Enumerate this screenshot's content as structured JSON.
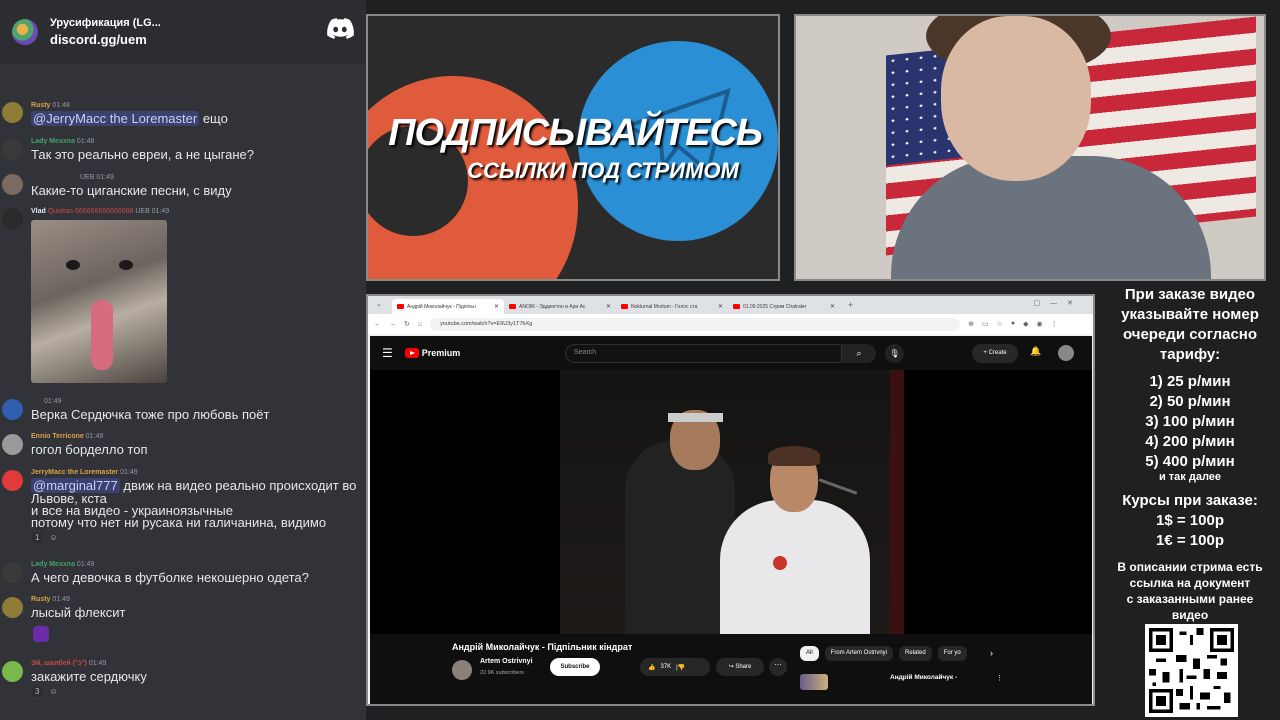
{
  "chat": {
    "server_name": "Урусификация (LG...",
    "server_invite": "discord.gg/uem",
    "messages": [
      {
        "author": "Rusty",
        "time": "01:48",
        "text": "ещо",
        "mention": "@JerryMacc the Loremaster",
        "author_color": "#d9a24a"
      },
      {
        "author": "Lady Mexxna",
        "time": "01:48",
        "text": "Так это реально евреи, а не цыгане?",
        "author_color": "#47a16b"
      },
      {
        "author": "",
        "badge": "UEB",
        "time": "01:49",
        "text": "Какие-то циганские песни, с виду",
        "author_color": "#949ba4"
      },
      {
        "author": "Vlad",
        "author_extra": "Quiskas 666666666666666",
        "badge": "UEB",
        "time": "01:49",
        "text": "",
        "author_color": "#e6e7ea"
      },
      {
        "author": "",
        "time": "01:49",
        "text": "Верка Сердючка тоже про любовь поёт",
        "author_color": "#949ba4"
      },
      {
        "author": "Ennio Terricone",
        "time": "01:49",
        "text": "гогол борделло топ",
        "author_color": "#d9a24a"
      },
      {
        "author": "JerryMacc the Loremaster",
        "time": "01:49",
        "mention": "@marginal777",
        "text": "движ на видео реально происходит во",
        "text2": "Львове, кста",
        "text3": "и все на видео - украиноязычные",
        "text4": "потому что нет ни русака ни галичанина, видимо",
        "reaction_count": "1",
        "author_color": "#d9a24a"
      },
      {
        "author": "Lady Mexxna",
        "time": "01:49",
        "text": "А чего девочка в футболке некошерно одета?",
        "author_color": "#47a16b"
      },
      {
        "author": "Rusty",
        "time": "01:49",
        "text": "лысый флексит",
        "author_color": "#d9a24a"
      },
      {
        "author": "Эй, шалбей (°ʖ°)",
        "time": "01:49",
        "text": "закажите сердючку",
        "reaction_count": "3",
        "author_color": "#c94b4b"
      }
    ]
  },
  "promo": {
    "title": "ПОДПИСЫВАЙТЕСЬ",
    "subtitle": "ССЫЛКИ ПОД СТРИМОМ"
  },
  "browser": {
    "tabs": [
      {
        "label": "Андрій Миколайчук - Підпільн"
      },
      {
        "label": "ANOIR - Эддингтон и Ари Ас"
      },
      {
        "label": "Nokturnal Mortum - Голос ста"
      },
      {
        "label": "01.09.2025 Стрим Chatraler"
      }
    ],
    "url": "youtube.com/watch?v=E9U3y1T7bXg"
  },
  "youtube": {
    "brand": "Premium",
    "search_placeholder": "Search",
    "create_label": "Create",
    "video_title": "Андрій Миколайчук - Підпільник кіндрат",
    "channel_name": "Artem Ostrivnyi",
    "channel_subs": "22.9K subscribers",
    "subscribe_label": "Subscribe",
    "likes": "37K",
    "share_label": "Share",
    "chips": [
      "All",
      "From Artem Ostrivnyi",
      "Related",
      "For yo"
    ],
    "related_title": "Андрій Миколайчук -"
  },
  "info": {
    "l1": "При заказе видео",
    "l2": "указывайте номер",
    "l3": "очереди согласно",
    "l4": "тарифу:",
    "t1": "1) 25 р/мин",
    "t2": "2) 50 р/мин",
    "t3": "3) 100 р/мин",
    "t4": "4) 200 р/мин",
    "t5": "5) 400 р/мин",
    "t6": "и так далее",
    "c1": "Курсы при заказе:",
    "c2": "1$ = 100р",
    "c3": "1€ = 100р",
    "d1": "В описании стрима есть",
    "d2": "ссылка на документ",
    "d3": "с заказанными ранее",
    "d4": "видео"
  },
  "colors": {
    "discord_bg": "#313338",
    "accent_blue": "#2a8fd4",
    "accent_orange": "#e05b3c",
    "youtube_red": "#ff0000"
  }
}
